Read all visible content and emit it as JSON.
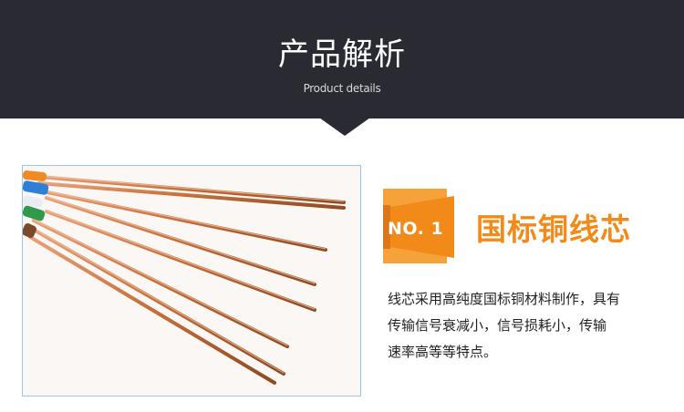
{
  "header": {
    "title": "产品解析",
    "subtitle": "Product details"
  },
  "feature": {
    "badge": "NO. 1",
    "title": "国标铜线芯",
    "description_lines": [
      "线芯采用高纯度国标铜材料制作，具有",
      "传输信号衰减小，信号损耗小，传输",
      "速率高等等特点。"
    ]
  },
  "colors": {
    "header_bg": "#2a2a33",
    "accent_orange": "#f28a1a",
    "copper": "#c9733f",
    "photo_border": "#9cc3e8"
  },
  "icons": {
    "badge_shape": "orange-folded-ribbon"
  }
}
